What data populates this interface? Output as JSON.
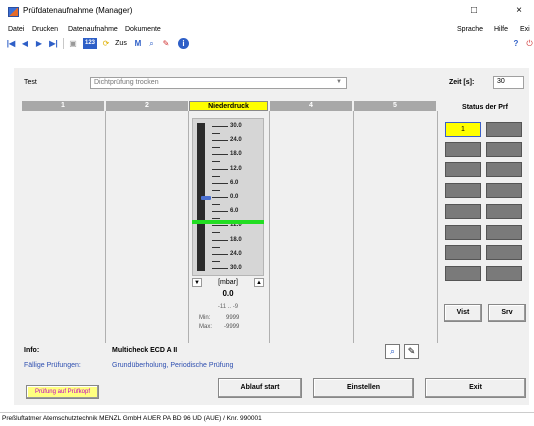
{
  "window": {
    "title": "Prüfdatenaufnahme  (Manager)",
    "minimize": "□",
    "close": "×"
  },
  "menu": {
    "left": [
      "Datei",
      "Drucken",
      "Datenaufnahme",
      "Dokumente"
    ],
    "right": [
      "Sprache",
      "Hilfe",
      "Exi"
    ]
  },
  "toolbar": {
    "first": "|◀",
    "prev": "◀",
    "next": "▶",
    "last": "▶|",
    "counter": "123",
    "zus_label": "Zus",
    "m_label": "M",
    "help": "?",
    "info": "i"
  },
  "test": {
    "label": "Test",
    "value": "Dichtprüfung trocken",
    "zeit_label": "Zeit [s]:",
    "zeit_value": "30"
  },
  "columns": [
    "1",
    "2",
    "Niederdruck",
    "4",
    "5"
  ],
  "gauge": {
    "scale": [
      "30.0",
      "24.0",
      "18.0",
      "12.0",
      "6.0",
      "0.0",
      "6.0",
      "12.0",
      "18.0",
      "24.0",
      "30.0"
    ],
    "unit": "[mbar]",
    "value": "0.0",
    "range": "-11 .. -9",
    "min_label": "Min:",
    "min_value": "9999",
    "max_label": "Max:",
    "max_value": "-9999",
    "indicator_color": "#4a6fd0",
    "limit_color": "#22dd22"
  },
  "status": {
    "title": "Status der Prf",
    "active_label": "1",
    "btn_vist": "Vist",
    "btn_srv": "Srv"
  },
  "info": {
    "label": "Info:",
    "value": "Multicheck ECD A II",
    "faellig_label": "Fällige Prüfungen:",
    "faellig_value": "Grundüberholung,  Periodische Prüfung"
  },
  "buttons": {
    "pruefkopf": "Prüfung auf Prüfkopf",
    "ablaufstart": "Ablauf start",
    "einstellen": "Einstellen",
    "exit": "Exit"
  },
  "statusbar": {
    "text": "Preßluftatmer  Atemschutztechnik MENZL GmbH  AUER PA BD 96 UD  (AUE) / Knr. 990001"
  }
}
